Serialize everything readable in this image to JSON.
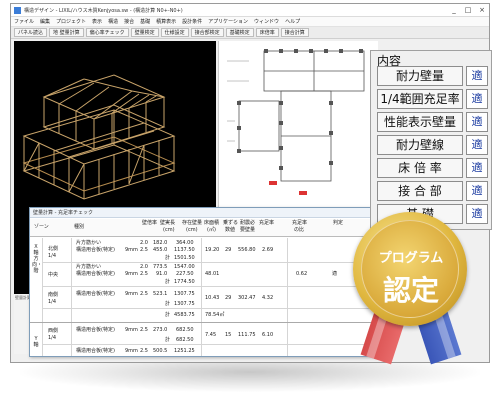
{
  "window": {
    "title": "構造デザイン - LIXIL/ハウス木質Kenjyosa.sw - (構造計算 N0+-N0+)",
    "controls": [
      "_",
      "□",
      "×"
    ]
  },
  "menubar": [
    "ファイル",
    "編集",
    "プロジェクト",
    "表示",
    "構造",
    "接合",
    "基礎",
    "積算表示",
    "設計条件",
    "アプリケーション",
    "ウィンドウ",
    "ヘルプ"
  ],
  "toolbar": [
    "パネル読込",
    "地 壁量計算",
    "偏心率チェック",
    "壁量検定",
    "仕様設定",
    "接合部検定",
    "基礎検定",
    "床倍率",
    "接合計算"
  ],
  "left_status": [
    "壁量計算書ボタン"
  ],
  "side_panel": {
    "title": "内容",
    "items": [
      {
        "label": "耐力壁量",
        "apply": "適"
      },
      {
        "label": "1/4範囲充足率",
        "apply": "適"
      },
      {
        "label": "性能表示壁量",
        "apply": "適"
      },
      {
        "label": "耐力壁線",
        "apply": "適"
      },
      {
        "label": "床 倍 率",
        "apply": "適"
      },
      {
        "label": "接 合 部",
        "apply": "適"
      },
      {
        "label": "基 礎",
        "apply": "適"
      }
    ]
  },
  "dialog": {
    "title": "壁量計算 - 充足率チェック",
    "close": "×",
    "headers": {
      "zone": "ゾーン",
      "type": "種別",
      "factor": "壁倍率",
      "length_top": "壁実長",
      "length_unit": "(cm)",
      "amount_top": "存在壁量",
      "amount_unit": "(cm)",
      "area_top": "床面積",
      "area_unit": "(㎡)",
      "mult_top": "乗ずる",
      "mult_bottom": "数値",
      "req_top": "耐震必",
      "req_bottom": "要壁量",
      "rate": "充足率",
      "ratio_top": "充足率",
      "ratio_bottom": "の比",
      "judge": "判定"
    },
    "axis_x": "X軸方向・階",
    "axis_y": "Y軸",
    "zones": [
      {
        "name": "北側",
        "sub": "1/4",
        "rows": [
          {
            "type": "片方筋かい",
            "factor": "2.0",
            "length": "182.0",
            "amount": "364.00"
          },
          {
            "type": "構造用合板(特定)",
            "unit": "9mm",
            "factor": "2.5",
            "length": "455.0",
            "amount": "1137.50"
          }
        ],
        "total_label": "計",
        "total": "1501.50",
        "area": "19.20",
        "mult": "29",
        "req": "556.80",
        "rate": "2.69"
      },
      {
        "name": "中央",
        "sub": "",
        "rows": [
          {
            "type": "片方筋かい",
            "factor": "2.0",
            "length": "773.5",
            "amount": "1547.00"
          },
          {
            "type": "構造用合板(特定)",
            "unit": "9mm",
            "factor": "2.5",
            "length": "91.0",
            "amount": "227.50"
          }
        ],
        "total_label": "計",
        "total": "1774.50",
        "area": "48.01",
        "ratio": "0.62",
        "judge": "適"
      },
      {
        "name": "南側",
        "sub": "1/4",
        "rows": [
          {
            "type": "構造用合板(特定)",
            "unit": "9mm",
            "factor": "2.5",
            "length": "523.1",
            "amount": "1307.75"
          }
        ],
        "total_label": "計",
        "total": "1307.75",
        "area": "10.43",
        "mult": "29",
        "req": "302.47",
        "rate": "4.32"
      },
      {
        "name": "",
        "sub": "",
        "rows": [],
        "total_label": "計",
        "total": "4583.75",
        "area": "78.54㎡"
      },
      {
        "name": "西側",
        "sub": "1/4",
        "rows": [
          {
            "type": "構造用合板(特定)",
            "unit": "9mm",
            "factor": "2.5",
            "length": "273.0",
            "amount": "682.50"
          }
        ],
        "total_label": "計",
        "total": "682.50",
        "area": "7.45",
        "mult": "15",
        "req": "111.75",
        "rate": "6.10"
      },
      {
        "name": "",
        "sub": "",
        "rows": [
          {
            "type": "構造用合板(特定)",
            "unit": "9mm",
            "factor": "2.5",
            "length": "500.5",
            "amount": "1251.25"
          }
        ]
      }
    ]
  },
  "badge": {
    "line1": "プログラム",
    "line2": "認定",
    "gold": "#d9a93a",
    "ribbon_left": "#d64a4a",
    "ribbon_right": "#3a56b8"
  }
}
